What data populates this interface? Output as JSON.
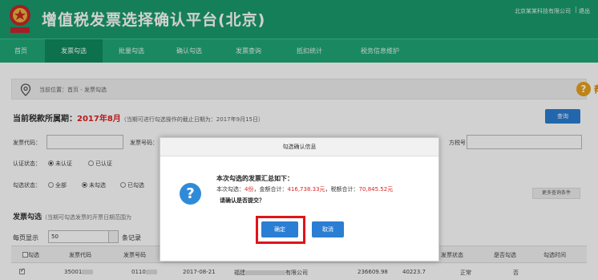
{
  "header": {
    "title": "增值税发票选择确认平台(北京)",
    "user": "北京某某科技有限公司",
    "separator": "|",
    "logout": "退出"
  },
  "nav": {
    "items": [
      {
        "label": "首页"
      },
      {
        "label": "发票勾选"
      },
      {
        "label": "批量勾选"
      },
      {
        "label": "确认勾选"
      },
      {
        "label": "发票查询"
      },
      {
        "label": "抵扣统计"
      },
      {
        "label": "税务信息维护"
      }
    ]
  },
  "breadcrumb": {
    "text": "当前位置：首页 - 发票勾选",
    "help_label": "帮助",
    "help_glyph": "?"
  },
  "period": {
    "label": "当前税款所属期：",
    "month": "2017年8月",
    "note": "（当期可进行勾选操作的截止日期为：2017年9月15日）"
  },
  "query_button": "查询",
  "form": {
    "invoice_code_label": "发票代码：",
    "invoice_number_label": "发票号码：",
    "seller_tax_label": "方税号：",
    "cert_status_label": "认证状态：",
    "cert_options": [
      "未认证",
      "已认证"
    ],
    "select_status_label": "勾选状态：",
    "select_options": [
      "全部",
      "未勾选",
      "已勾选"
    ],
    "more_button": "更多查询条件"
  },
  "section": {
    "title": "发票勾选",
    "note": "（当期可勾选发票的开票日期范围为"
  },
  "perpage": {
    "label": "每页显示",
    "value": "50",
    "suffix": "条记录"
  },
  "table": {
    "headers": [
      "勾选",
      "发票代码",
      "发票号码",
      "发票状态",
      "是否勾选",
      "勾选时间"
    ],
    "row": {
      "code": "35001",
      "number": "0110",
      "date": "2017-08-21",
      "seller": "福建",
      "seller_suffix": "有限公司",
      "amount": "236609.98",
      "tax": "40223.7",
      "status": "正常",
      "selected": "否"
    }
  },
  "modal": {
    "title": "勾选确认信息",
    "summary_title": "本次勾选的发票汇总如下：",
    "count_prefix": "本次勾选：",
    "count": "4份",
    "amount_prefix": "，金额合计：",
    "amount": "416,738.33元",
    "tax_prefix": "，税额合计：",
    "tax": "70,845.52元",
    "confirm_text": "请确认是否提交？",
    "ok": "确定",
    "cancel": "取消",
    "icon_glyph": "?"
  },
  "colors": {
    "header_green": "#1a9b6e",
    "accent_blue": "#2a7ed3",
    "highlight_red": "#e0141a"
  }
}
